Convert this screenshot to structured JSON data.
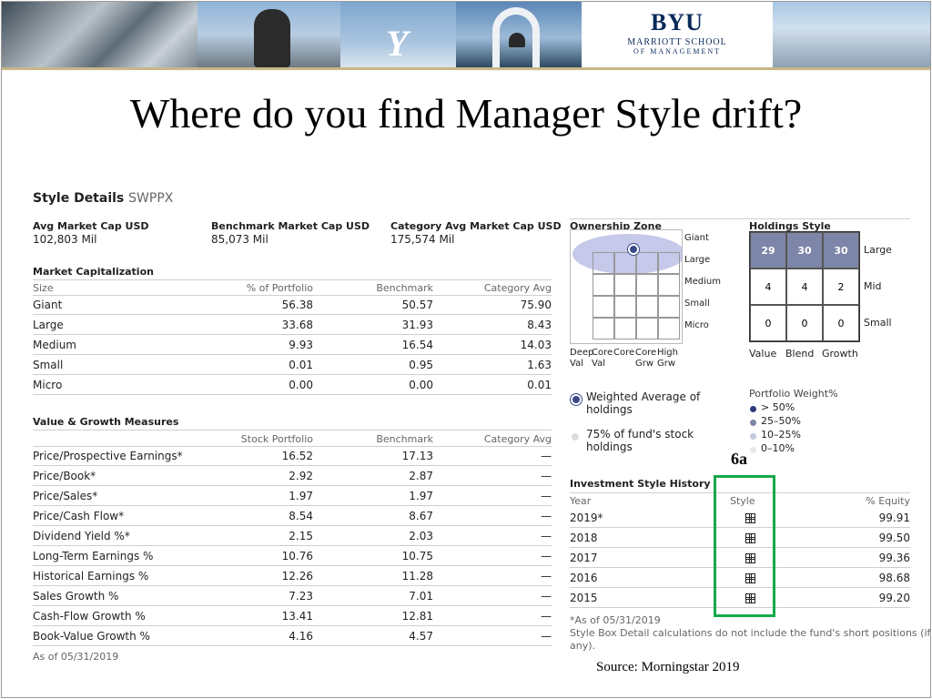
{
  "banner": {
    "byu": "BYU",
    "school_line1": "MARRIOTT SCHOOL",
    "school_line2": "OF MANAGEMENT"
  },
  "slide_title": "Where do you find Manager Style drift?",
  "style_details": {
    "heading": "Style Details",
    "ticker": "SWPPX",
    "avg_market_cap": {
      "label": "Avg Market Cap USD",
      "value": "102,803 Mil"
    },
    "benchmark_market_cap": {
      "label": "Benchmark Market Cap USD",
      "value": "85,073 Mil"
    },
    "category_market_cap": {
      "label": "Category Avg Market Cap USD",
      "value": "175,574 Mil"
    }
  },
  "market_cap": {
    "heading": "Market Capitalization",
    "columns": [
      "Size",
      "% of Portfolio",
      "Benchmark",
      "Category Avg"
    ],
    "rows": [
      [
        "Giant",
        "56.38",
        "50.57",
        "75.90"
      ],
      [
        "Large",
        "33.68",
        "31.93",
        "8.43"
      ],
      [
        "Medium",
        "9.93",
        "16.54",
        "14.03"
      ],
      [
        "Small",
        "0.01",
        "0.95",
        "1.63"
      ],
      [
        "Micro",
        "0.00",
        "0.00",
        "0.01"
      ]
    ]
  },
  "value_growth": {
    "heading": "Value & Growth Measures",
    "columns": [
      "",
      "Stock Portfolio",
      "Benchmark",
      "Category Avg"
    ],
    "rows": [
      [
        "Price/Prospective Earnings*",
        "16.52",
        "17.13",
        "—"
      ],
      [
        "Price/Book*",
        "2.92",
        "2.87",
        "—"
      ],
      [
        "Price/Sales*",
        "1.97",
        "1.97",
        "—"
      ],
      [
        "Price/Cash Flow*",
        "8.54",
        "8.67",
        "—"
      ],
      [
        "Dividend Yield %*",
        "2.15",
        "2.03",
        "—"
      ],
      [
        "Long-Term Earnings %",
        "10.76",
        "10.75",
        "—"
      ],
      [
        "Historical Earnings %",
        "12.26",
        "11.28",
        "—"
      ],
      [
        "Sales Growth %",
        "7.23",
        "7.01",
        "—"
      ],
      [
        "Cash-Flow Growth %",
        "13.41",
        "12.81",
        "—"
      ],
      [
        "Book-Value Growth %",
        "4.16",
        "4.57",
        "—"
      ]
    ],
    "as_of": "As of 05/31/2019"
  },
  "ownership_zone": {
    "heading": "Ownership Zone",
    "size_labels": [
      "Giant",
      "Large",
      "Medium",
      "Small",
      "Micro"
    ],
    "style_labels": [
      [
        "Deep",
        "Val"
      ],
      [
        "Core",
        "Val"
      ],
      [
        "Core",
        ""
      ],
      [
        "Core",
        "Grw"
      ],
      [
        "High",
        "Grw"
      ]
    ],
    "legend": [
      {
        "text_line1": "Weighted Average of",
        "text_line2": "holdings"
      },
      {
        "text_line1": "75% of fund's stock",
        "text_line2": "holdings"
      }
    ]
  },
  "holdings_style": {
    "heading": "Holdings Style",
    "grid": [
      [
        "29",
        "30",
        "30"
      ],
      [
        "4",
        "4",
        "2"
      ],
      [
        "0",
        "0",
        "0"
      ]
    ],
    "row_labels": [
      "Large",
      "Mid",
      "Small"
    ],
    "col_labels": [
      "Value",
      "Blend",
      "Growth"
    ],
    "portfolio_weight_heading": "Portfolio Weight%",
    "weights": [
      "> 50%",
      "25–50%",
      "10–25%",
      "0–10%"
    ]
  },
  "callout_label": "6a",
  "style_history": {
    "heading": "Investment Style History",
    "columns": [
      "Year",
      "Style",
      "% Equity"
    ],
    "rows": [
      [
        "2019*",
        "99.91"
      ],
      [
        "2018",
        "99.50"
      ],
      [
        "2017",
        "99.36"
      ],
      [
        "2016",
        "98.68"
      ],
      [
        "2015",
        "99.20"
      ]
    ],
    "note1": "*As of 05/31/2019",
    "note2": "Style Box Detail calculations do not include the fund's short positions (if",
    "note3": "any)."
  },
  "source": "Source:  Morningstar 2019",
  "colors": {
    "green_box": "#17a84a",
    "dark_cell": "#7d86a8",
    "zone_ellipse": "#c6c9ea"
  }
}
